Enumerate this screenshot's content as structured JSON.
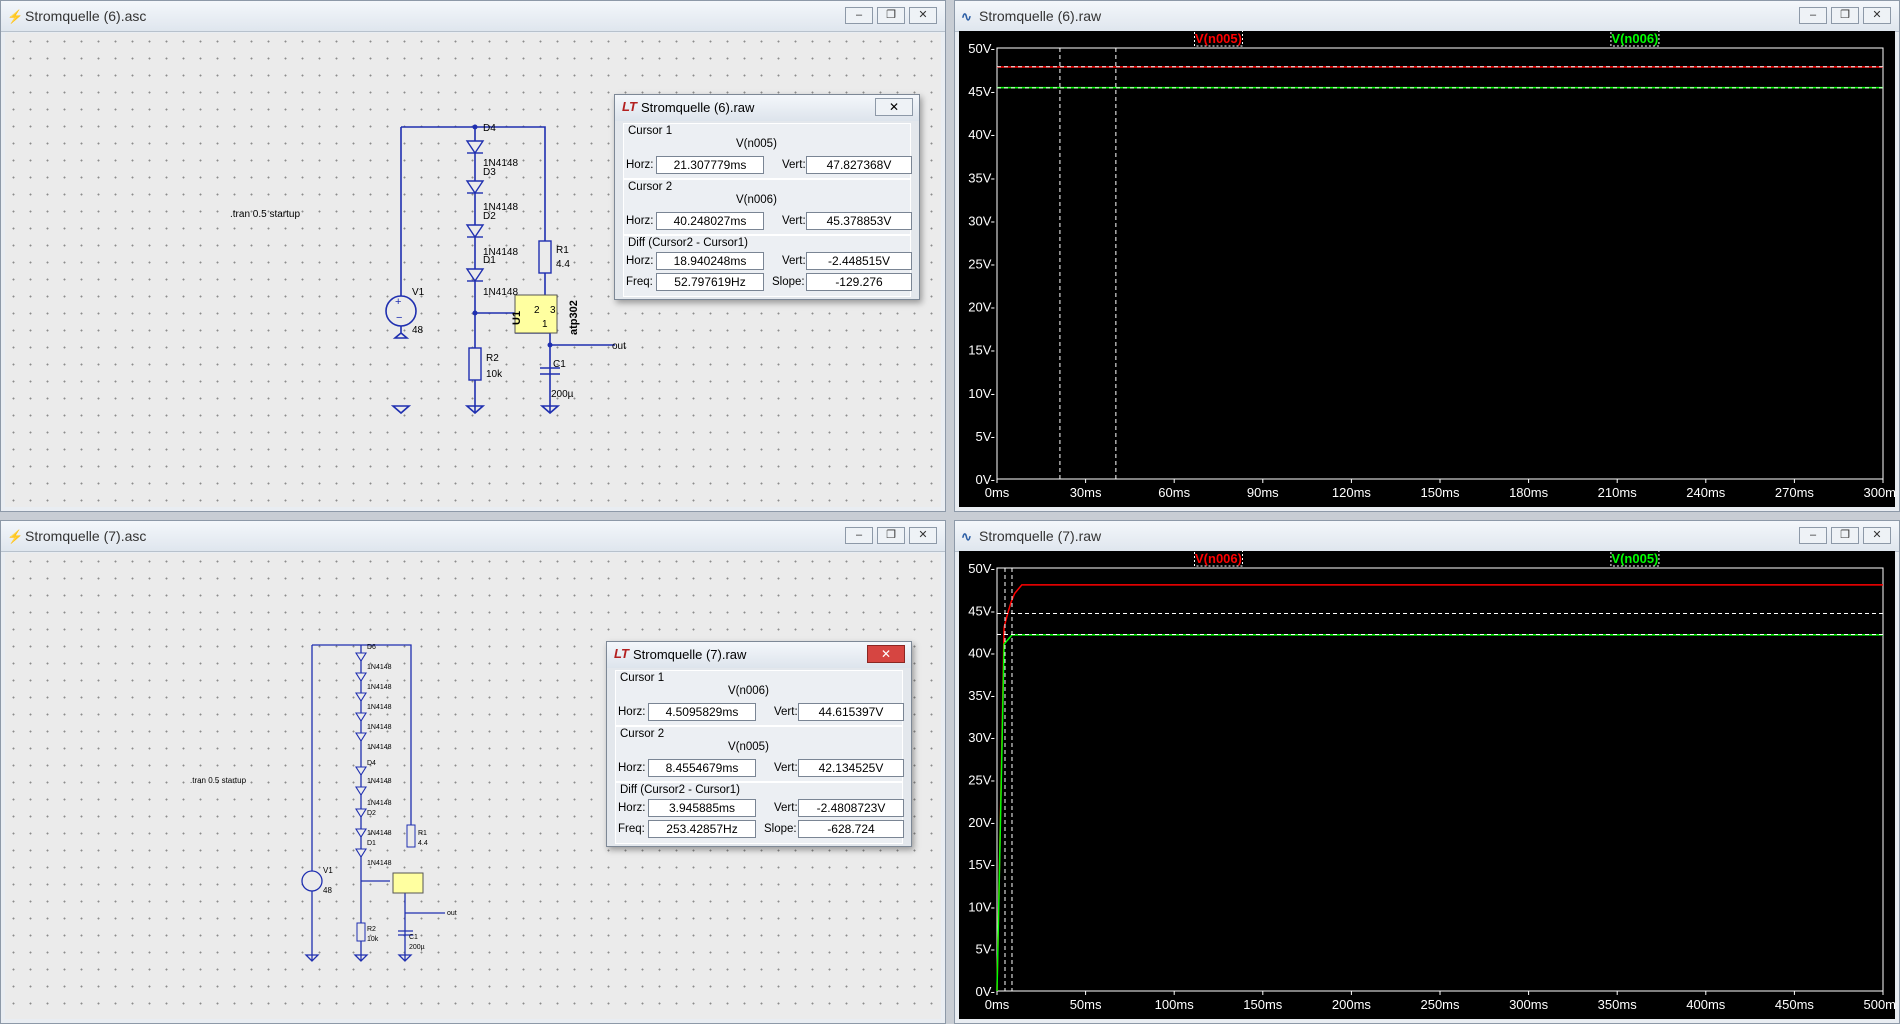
{
  "sch6": {
    "title": "Stromquelle (6).asc",
    "directive": ".tran 0.5 startup",
    "v1_name": "V1",
    "v1_value": "48",
    "d4": "D4",
    "d3": "D3",
    "d2": "D2",
    "d1": "D1",
    "diode_model": "1N4148",
    "r1_name": "R1",
    "r1_value": "4.4",
    "r2_name": "R2",
    "r2_value": "10k",
    "c1_name": "C1",
    "c1_value": "200µ",
    "u1": "U1",
    "u1_model": "atp302",
    "pin2": "2",
    "pin3": "3",
    "pin1": "1",
    "out": "out"
  },
  "sch7": {
    "title": "Stromquelle (7).asc",
    "directive": ".tran 0.5 startup",
    "v1_name": "V1",
    "v1_value": "48",
    "d6": "D6",
    "d4": "D4",
    "d2": "D2",
    "d1": "D1",
    "diode_model": "1N4148",
    "r1_name": "R1",
    "r1_value": "4.4",
    "r2_name": "R2",
    "r2_value": "10k",
    "c1_name": "C1",
    "c1_value": "200µ",
    "out": "out"
  },
  "dlg6": {
    "title": "Stromquelle (6).raw",
    "close": "✕",
    "cursor1": "Cursor 1",
    "c1_trace": "V(n005)",
    "c1_horz": "21.307779ms",
    "c1_vert": "47.827368V",
    "cursor2": "Cursor 2",
    "c2_trace": "V(n006)",
    "c2_horz": "40.248027ms",
    "c2_vert": "45.378853V",
    "diff": "Diff (Cursor2 - Cursor1)",
    "d_horz": "18.940248ms",
    "d_vert": "-2.448515V",
    "d_freq": "52.797619Hz",
    "d_slope": "-129.276",
    "horz_label": "Horz:",
    "vert_label": "Vert:",
    "freq_label": "Freq:",
    "slope_label": "Slope:"
  },
  "dlg7": {
    "title": "Stromquelle (7).raw",
    "close": "✕",
    "cursor1": "Cursor 1",
    "c1_trace": "V(n006)",
    "c1_horz": "4.5095829ms",
    "c1_vert": "44.615397V",
    "cursor2": "Cursor 2",
    "c2_trace": "V(n005)",
    "c2_horz": "8.4554679ms",
    "c2_vert": "42.134525V",
    "diff": "Diff (Cursor2 - Cursor1)",
    "d_horz": "3.945885ms",
    "d_vert": "-2.4808723V",
    "d_freq": "253.42857Hz",
    "d_slope": "-628.724",
    "horz_label": "Horz:",
    "vert_label": "Vert:",
    "freq_label": "Freq:",
    "slope_label": "Slope:"
  },
  "plot6_title": "Stromquelle (6).raw",
  "plot7_title": "Stromquelle (7).raw",
  "window_buttons": {
    "minimize": "–",
    "restore": "❐",
    "close": "✕"
  },
  "colors": {
    "red": "#ff0000",
    "green": "#00ff00",
    "wire": "#1f2fb0"
  },
  "chart_data": [
    {
      "type": "line",
      "title": "",
      "xlabel": "",
      "ylabel": "",
      "xlim": [
        0,
        300
      ],
      "ylim": [
        0,
        50
      ],
      "x_ticks": [
        "0ms",
        "30ms",
        "60ms",
        "90ms",
        "120ms",
        "150ms",
        "180ms",
        "210ms",
        "240ms",
        "270ms",
        "300ms"
      ],
      "y_ticks": [
        "0V-",
        "5V-",
        "10V-",
        "15V-",
        "20V-",
        "25V-",
        "30V-",
        "35V-",
        "40V-",
        "45V-",
        "50V-"
      ],
      "series": [
        {
          "name": "V(n005)",
          "color": "#ff0000",
          "x": [
            0,
            300
          ],
          "y": [
            47.8,
            47.8
          ]
        },
        {
          "name": "V(n006)",
          "color": "#00ff00",
          "x": [
            0,
            300
          ],
          "y": [
            45.4,
            45.4
          ]
        }
      ],
      "cursors_x_ms": [
        21.307779,
        40.248027
      ],
      "cursor_levels_v": [
        47.827368,
        45.378853
      ],
      "grid": false
    },
    {
      "type": "line",
      "title": "",
      "xlabel": "",
      "ylabel": "",
      "xlim": [
        0,
        500
      ],
      "ylim": [
        0,
        50
      ],
      "x_ticks": [
        "0ms",
        "50ms",
        "100ms",
        "150ms",
        "200ms",
        "250ms",
        "300ms",
        "350ms",
        "400ms",
        "450ms",
        "500ms"
      ],
      "y_ticks": [
        "0V-",
        "5V-",
        "10V-",
        "15V-",
        "20V-",
        "25V-",
        "30V-",
        "35V-",
        "40V-",
        "45V-",
        "50V-"
      ],
      "series": [
        {
          "name": "V(n006)",
          "color": "#ff0000",
          "x": [
            0,
            4,
            6,
            8,
            10,
            14,
            500
          ],
          "y": [
            0,
            43,
            44.6,
            46,
            47,
            48,
            48
          ]
        },
        {
          "name": "V(n005)",
          "color": "#00ff00",
          "x": [
            0,
            4,
            8.5,
            500
          ],
          "y": [
            0,
            41,
            42.1,
            42.1
          ]
        }
      ],
      "cursors_x_ms": [
        4.5095829,
        8.4554679
      ],
      "cursor_levels_v": [
        44.615397,
        42.134525
      ],
      "grid": false
    }
  ]
}
